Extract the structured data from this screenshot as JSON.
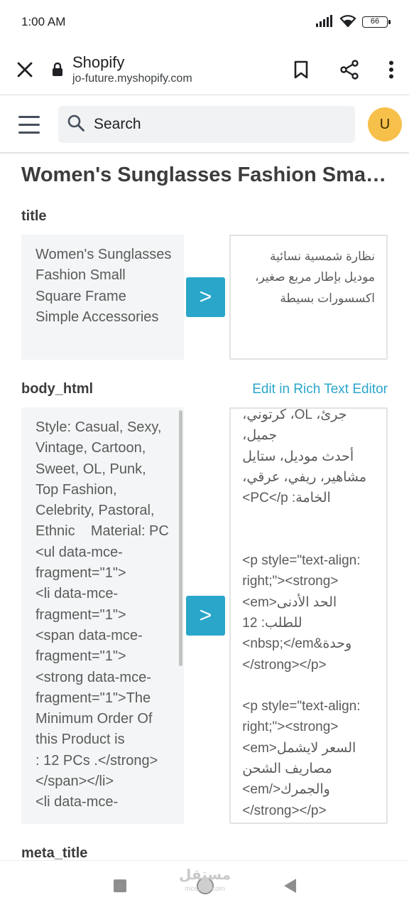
{
  "status_bar": {
    "time": "1:00 AM",
    "battery": "66",
    "icons": [
      "signal-icon",
      "wifi-icon",
      "battery-icon"
    ]
  },
  "browser": {
    "title": "Shopify",
    "url": "jo-future.myshopify.com",
    "icons": [
      "close-icon",
      "lock-icon",
      "bookmark-icon",
      "share-icon",
      "more-vert-icon"
    ]
  },
  "header": {
    "search_placeholder": "Search",
    "avatar_initial": "U"
  },
  "main": {
    "page_title": "Women's Sunglasses Fashion Small Square Frame Simple Accessories",
    "title_field": {
      "label": "title",
      "source": "Women's Sunglasses Fashion Small Square Frame Simple Accessories",
      "target": "نظارة شمسية نسائية موديل بإطار مربع صغير، اكسسورات بسيطة",
      "copy_label": ">"
    },
    "body_field": {
      "label": "body_html",
      "link": "Edit in Rich Text Editor",
      "source": "Style: Casual, Sexy, Vintage, Cartoon, Sweet, OL, Punk, Top Fashion, Celebrity, Pastoral, Ethnic    Material: PC\n<ul data-mce-fragment=\"1\">\n<li data-mce-fragment=\"1\">\n<span data-mce-fragment=\"1\">\n<strong data-mce-fragment=\"1\">The Minimum Order Of this Product is\n: 12 PCs .</strong>\n</span></li>\n<li data-mce-",
      "target_lines": [
        "جرئ، OL، كرتوني، جميل،",
        "أحدث موديل، ستايل",
        "مشاهير، ريفي، عرقي،",
        "الخامة: PC</p>",
        "",
        "",
        "<p style=\"text-align:",
        "right;\"><strong>",
        "<em>الحد الأدنى",
        "للطلب: 12",
        "وحدة&nbsp;</em>",
        "</strong></p>",
        "",
        "<p style=\"text-align:",
        "right;\"><strong>",
        "<em>السعر لايشمل",
        "مصاريف الشحن",
        "والجمرك</em>",
        "</strong></p>"
      ],
      "copy_label": ">"
    },
    "next_label": "meta_title"
  },
  "nav": {
    "watermark": "مستقل",
    "watermark_sub": "mostaql.com"
  },
  "colors": {
    "accent": "#2ba6cb",
    "avatar": "#f7c04a",
    "field_bg": "#f4f5f6"
  }
}
